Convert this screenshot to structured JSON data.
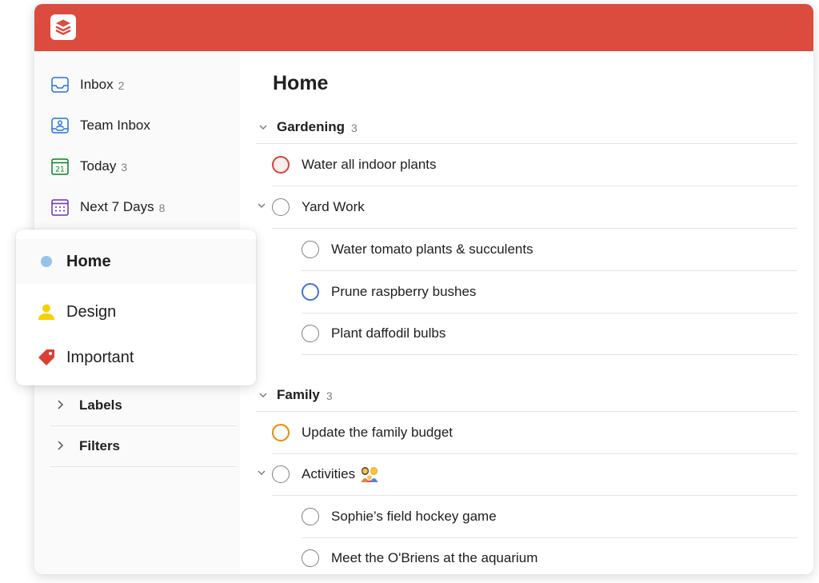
{
  "colors": {
    "topbar": "#db4c3f",
    "sidebar_bg": "#fafafa",
    "home_dot": "#96c3eb",
    "design_person": "#fad000",
    "important_tag": "#db4035"
  },
  "sidebar": {
    "items": [
      {
        "label": "Inbox",
        "count": "2",
        "icon": "inbox-icon"
      },
      {
        "label": "Team Inbox",
        "count": "",
        "icon": "team-inbox-icon"
      },
      {
        "label": "Today",
        "count": "3",
        "icon": "calendar-today-icon"
      },
      {
        "label": "Next 7 Days",
        "count": "8",
        "icon": "calendar-week-icon"
      }
    ],
    "collapsed": [
      {
        "label": "Labels"
      },
      {
        "label": "Filters"
      }
    ]
  },
  "popover": {
    "items": [
      {
        "label": "Home",
        "icon": "dot-icon",
        "selected": true
      },
      {
        "label": "Design",
        "icon": "person-icon",
        "selected": false
      },
      {
        "label": "Important",
        "icon": "tag-icon",
        "selected": false
      }
    ]
  },
  "main": {
    "title": "Home",
    "sections": [
      {
        "name": "Gardening",
        "count": "3",
        "tasks": [
          {
            "text": "Water all indoor plants",
            "priority": "red"
          },
          {
            "text": "Yard Work",
            "priority": "none",
            "has_children": true
          },
          {
            "text": "Water tomato plants & succulents",
            "priority": "none",
            "indent": 1
          },
          {
            "text": "Prune raspberry bushes",
            "priority": "blue",
            "indent": 1
          },
          {
            "text": "Plant daffodil bulbs",
            "priority": "none",
            "indent": 1
          }
        ]
      },
      {
        "name": "Family",
        "count": "3",
        "tasks": [
          {
            "text": "Update the family budget",
            "priority": "orange"
          },
          {
            "text": "Activities",
            "priority": "none",
            "has_children": true,
            "emoji": "family-emoji"
          },
          {
            "text": "Sophie’s field hockey game",
            "priority": "none",
            "indent": 1
          },
          {
            "text": "Meet the O'Briens at the aquarium",
            "priority": "none",
            "indent": 1
          }
        ]
      }
    ]
  }
}
